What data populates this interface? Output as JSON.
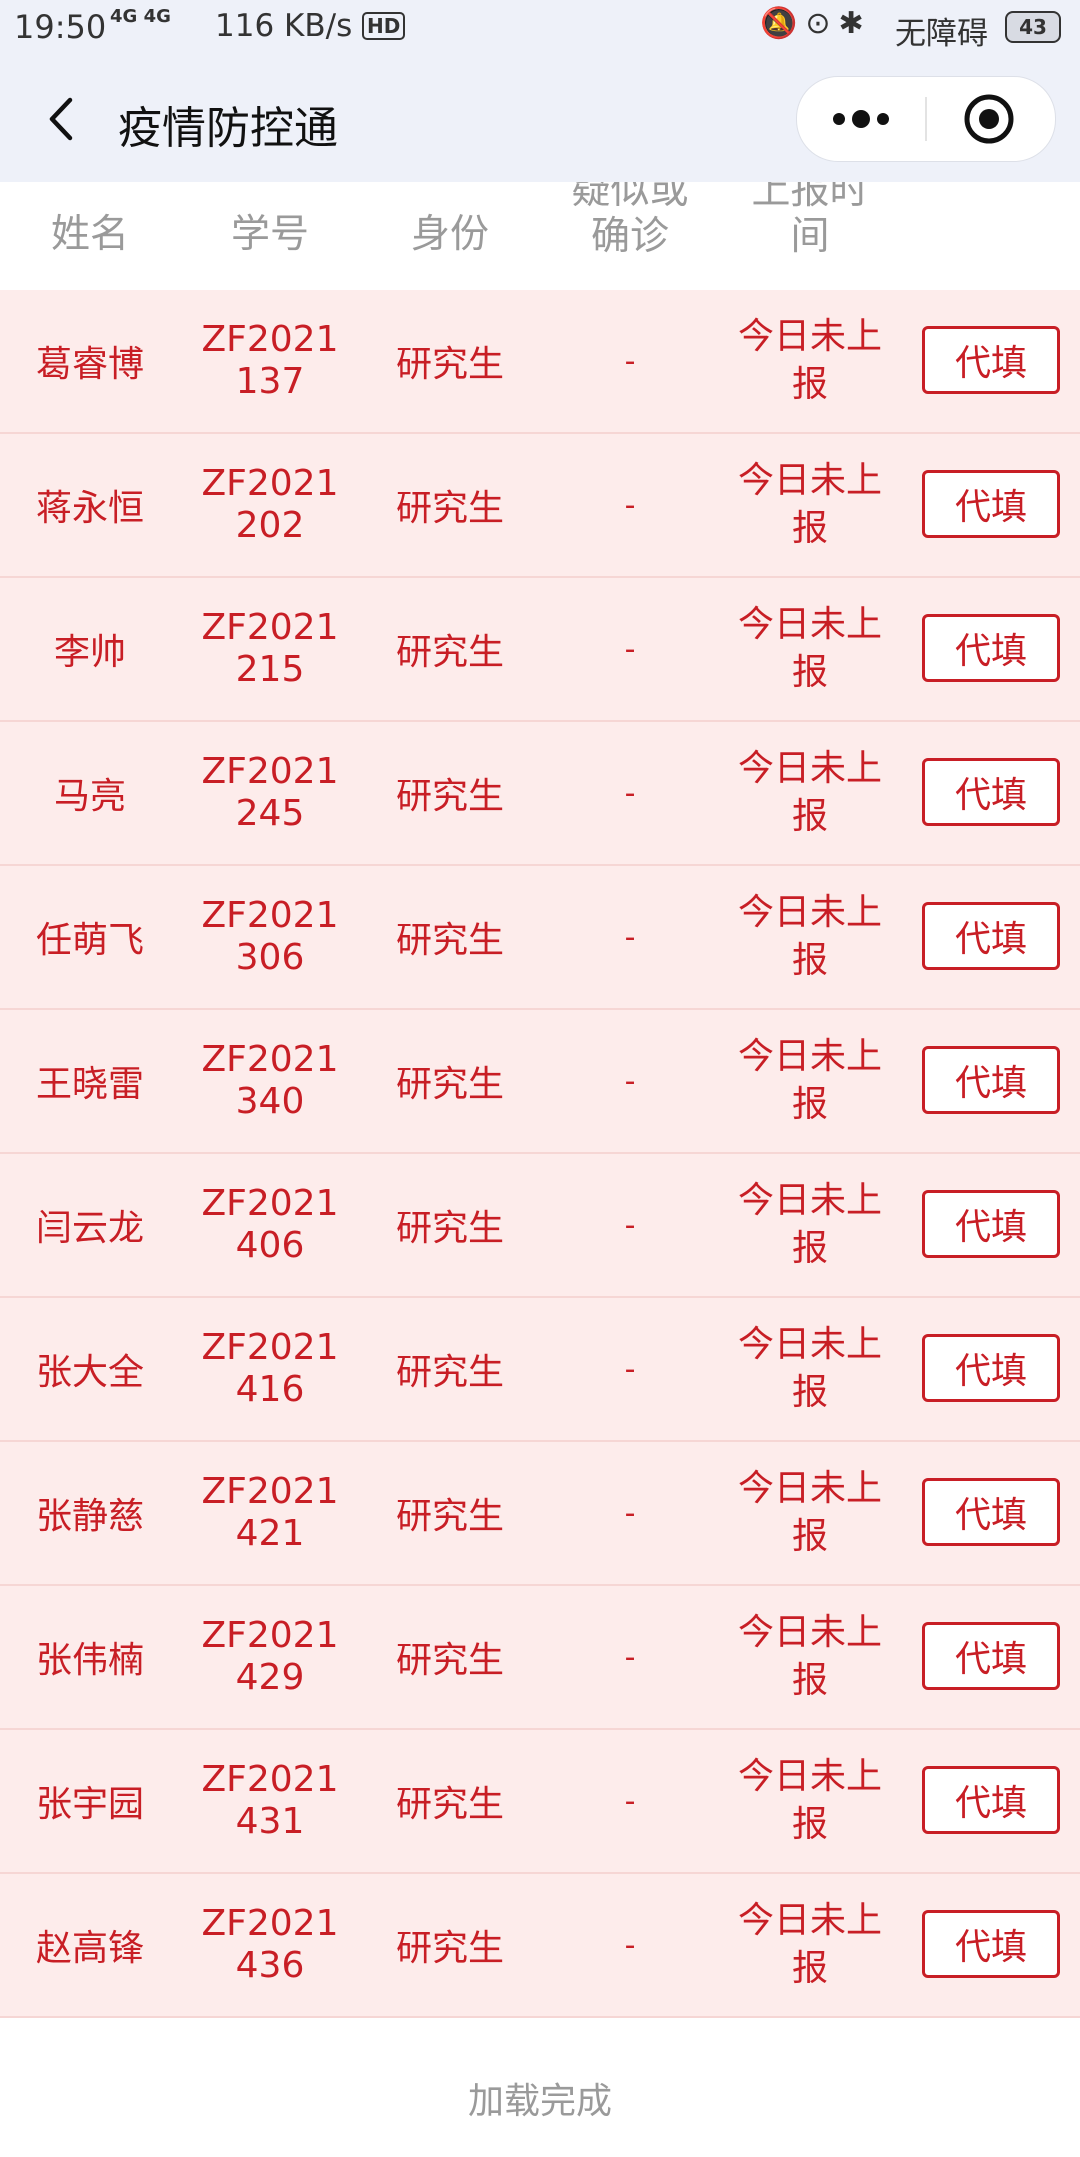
{
  "status_bar": {
    "time": "19:50",
    "network": "4G 4G",
    "speed": "116 KB/s",
    "hd": "HD",
    "accessibility": "无障碍",
    "battery": "43"
  },
  "nav": {
    "title": "疫情防控通"
  },
  "table": {
    "headers": [
      "姓名",
      "学号",
      "身份",
      "疑似或确诊",
      "上报时间"
    ],
    "action_label": "代填",
    "rows": [
      {
        "name": "葛睿博",
        "id": "ZF2021137",
        "role": "研究生",
        "suspected": "-",
        "report": "今日未上报"
      },
      {
        "name": "蒋永恒",
        "id": "ZF2021202",
        "role": "研究生",
        "suspected": "-",
        "report": "今日未上报"
      },
      {
        "name": "李帅",
        "id": "ZF2021215",
        "role": "研究生",
        "suspected": "-",
        "report": "今日未上报"
      },
      {
        "name": "马亮",
        "id": "ZF2021245",
        "role": "研究生",
        "suspected": "-",
        "report": "今日未上报"
      },
      {
        "name": "任萌飞",
        "id": "ZF2021306",
        "role": "研究生",
        "suspected": "-",
        "report": "今日未上报"
      },
      {
        "name": "王晓雷",
        "id": "ZF2021340",
        "role": "研究生",
        "suspected": "-",
        "report": "今日未上报"
      },
      {
        "name": "闫云龙",
        "id": "ZF2021406",
        "role": "研究生",
        "suspected": "-",
        "report": "今日未上报"
      },
      {
        "name": "张大全",
        "id": "ZF2021416",
        "role": "研究生",
        "suspected": "-",
        "report": "今日未上报"
      },
      {
        "name": "张静慈",
        "id": "ZF2021421",
        "role": "研究生",
        "suspected": "-",
        "report": "今日未上报"
      },
      {
        "name": "张伟楠",
        "id": "ZF2021429",
        "role": "研究生",
        "suspected": "-",
        "report": "今日未上报"
      },
      {
        "name": "张宇园",
        "id": "ZF2021431",
        "role": "研究生",
        "suspected": "-",
        "report": "今日未上报"
      },
      {
        "name": "赵高锋",
        "id": "ZF2021436",
        "role": "研究生",
        "suspected": "-",
        "report": "今日未上报"
      }
    ]
  },
  "footer": {
    "status": "加载完成"
  }
}
